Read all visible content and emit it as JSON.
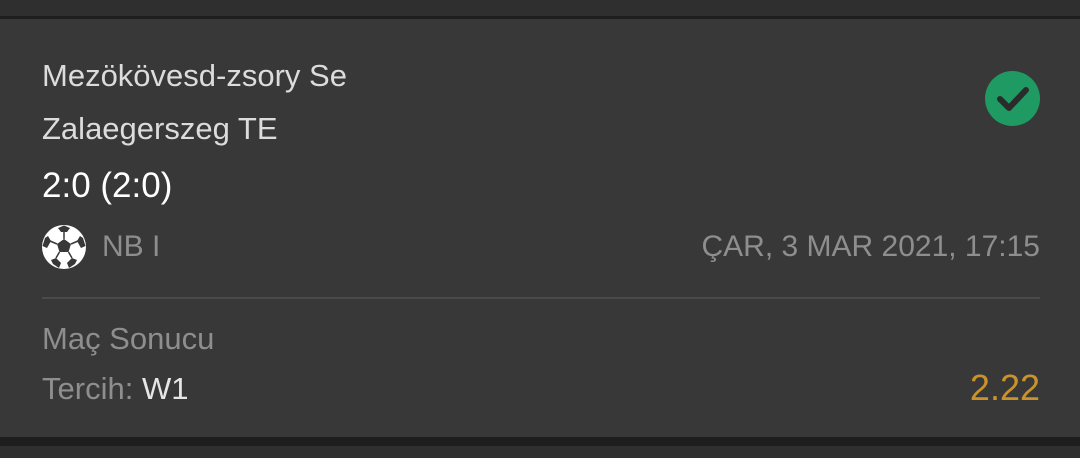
{
  "match": {
    "home_team": "Mezökövesd-zsory Se",
    "away_team": "Zalaegerszeg TE",
    "score": "2:0 (2:0)",
    "status_icon": "check-circle-icon",
    "status_color": "#1f9a63"
  },
  "meta": {
    "sport_icon": "soccer-ball-icon",
    "league": "NB I",
    "datetime": "ÇAR, 3 MAR 2021, 17:15"
  },
  "bet": {
    "market": "Maç Sonucu",
    "choice_label": "Tercih:",
    "choice_value": "W1",
    "odds": "2.22",
    "odds_color": "#c9922b"
  }
}
